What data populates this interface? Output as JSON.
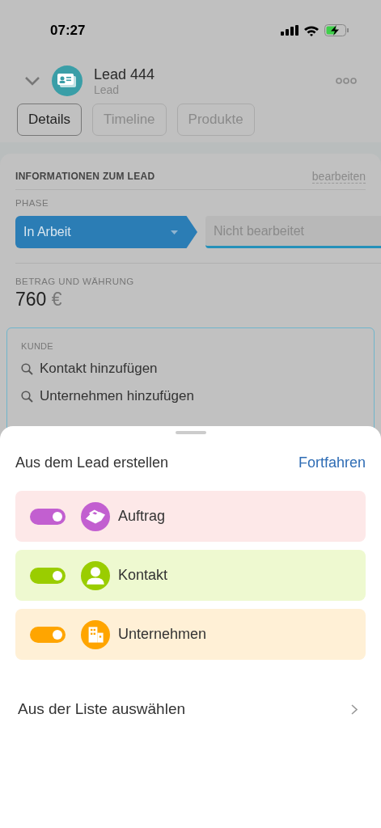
{
  "status_bar": {
    "time": "07:27"
  },
  "header": {
    "title": "Lead 444",
    "subtitle": "Lead"
  },
  "tabs": [
    {
      "label": "Details",
      "selected": true
    },
    {
      "label": "Timeline",
      "selected": false
    },
    {
      "label": "Produkte",
      "selected": false
    }
  ],
  "info_card": {
    "title": "INFORMATIONEN ZUM LEAD",
    "edit_link": "bearbeiten",
    "phase_label": "PHASE",
    "phases": [
      {
        "label": "In Arbeit",
        "selected": true
      },
      {
        "label": "Nicht bearbeitet",
        "selected": false
      }
    ],
    "amount_label": "BETRAG UND WÄHRUNG",
    "amount": "760",
    "currency": "€"
  },
  "client": {
    "label": "KUNDE",
    "actions": [
      "Kontakt hinzufügen",
      "Unternehmen hinzufügen"
    ]
  },
  "sheet": {
    "title": "Aus dem Lead erstellen",
    "action": "Fortfahren",
    "options": [
      {
        "label": "Auftrag",
        "kind": "deal",
        "on": true,
        "color": "#c25fd0"
      },
      {
        "label": "Kontakt",
        "kind": "contact",
        "on": true,
        "color": "#9acd00"
      },
      {
        "label": "Unternehmen",
        "kind": "company",
        "on": true,
        "color": "#ffa500"
      }
    ],
    "list_link": "Aus der Liste auswählen"
  }
}
